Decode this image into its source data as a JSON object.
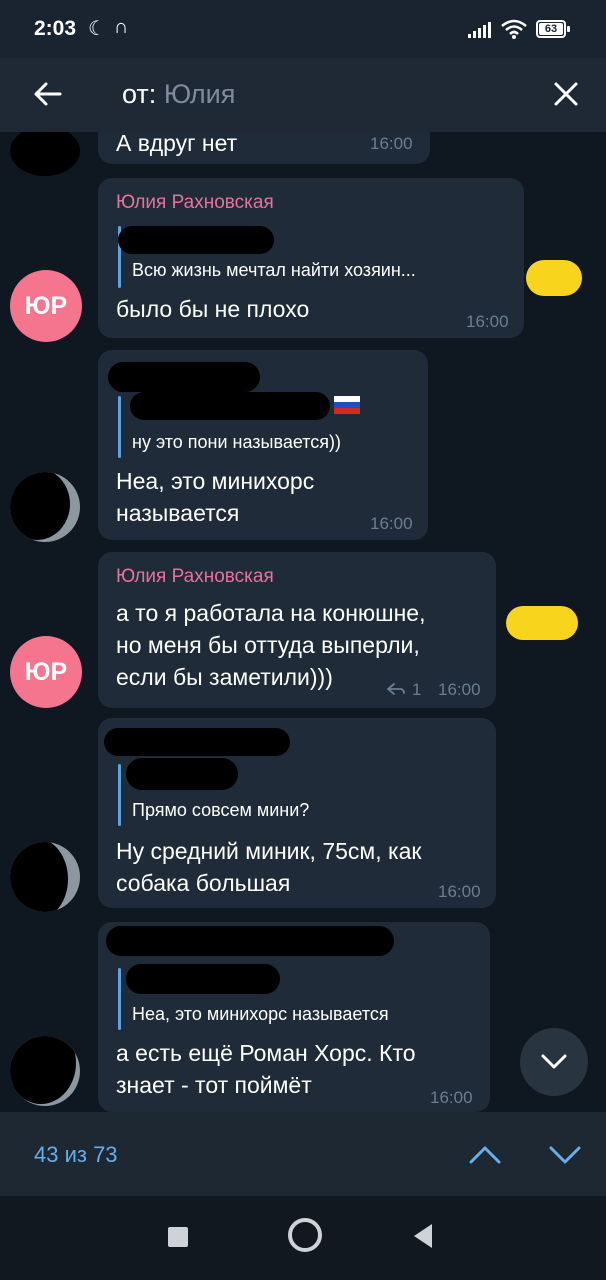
{
  "status_bar": {
    "time": "2:03",
    "battery": "63"
  },
  "search": {
    "prefix": "от:",
    "name": "Юлия"
  },
  "messages": [
    {
      "text": "А вдруг нет",
      "time": "16:00"
    },
    {
      "sender": "Юлия Рахновская",
      "avatar": "ЮР",
      "quote": "Всю жизнь мечтал найти хозяин...",
      "text": "было бы не плохо",
      "time": "16:00"
    },
    {
      "quote": "ну это пони называется))",
      "text_line1": "Неа, это минихорс",
      "text_line2": "называется",
      "time": "16:00"
    },
    {
      "sender": "Юлия Рахновская",
      "avatar": "ЮР",
      "text_line1": "а то я работала на конюшне,",
      "text_line2": "но меня бы оттуда выперли,",
      "text_line3": "если бы заметили)))",
      "replies": "1",
      "time": "16:00"
    },
    {
      "quote": "Прямо совсем мини?",
      "text_line1": "Ну средний миник, 75см, как",
      "text_line2": "собака большая",
      "time": "16:00"
    },
    {
      "quote": "Неа, это минихорс называется",
      "text_line1": "а есть ещё Роман Хорс. Кто",
      "text_line2": "знает - тот поймёт",
      "time": "16:00"
    }
  ],
  "search_results": {
    "counter": "43 из 73"
  },
  "colors": {
    "background": "#0f1821",
    "bubble": "#1f2b38",
    "sender_name": "#e6739b",
    "quote_bar": "#5aa3e4",
    "accent": "#66aee9",
    "avatar": "#f5758f"
  },
  "icons": {
    "back": "arrow-left-icon",
    "close": "close-icon",
    "scroll_down": "chevron-down-icon",
    "prev_result": "chevron-up-icon",
    "next_result": "chevron-down-icon",
    "reply": "reply-arrow-icon"
  }
}
